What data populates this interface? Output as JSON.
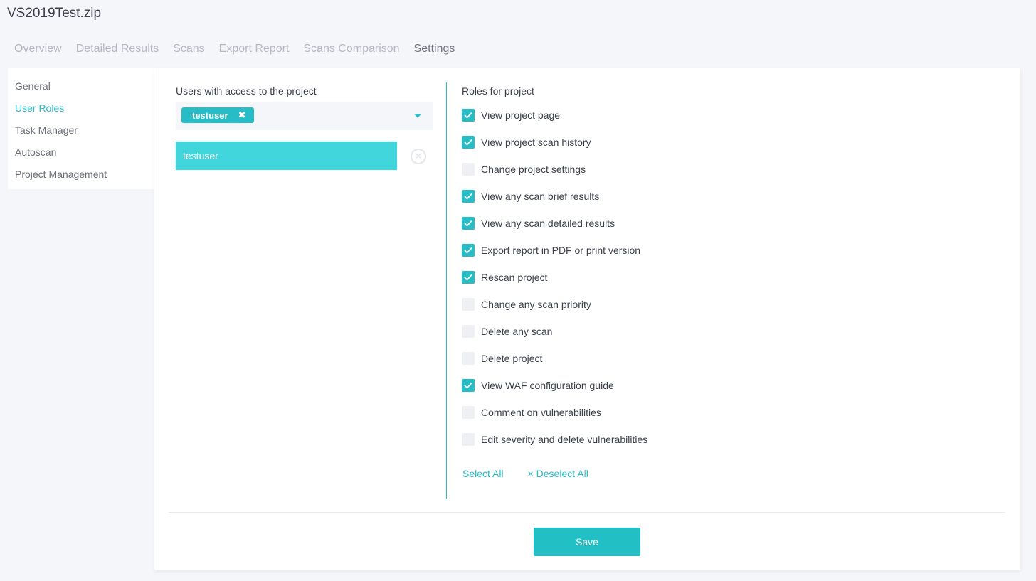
{
  "app": {
    "title": "VS2019Test.zip"
  },
  "tabs": [
    {
      "label": "Overview",
      "active": false
    },
    {
      "label": "Detailed Results",
      "active": false
    },
    {
      "label": "Scans",
      "active": false
    },
    {
      "label": "Export Report",
      "active": false
    },
    {
      "label": "Scans Comparison",
      "active": false
    },
    {
      "label": "Settings",
      "active": true
    }
  ],
  "sidebar": {
    "items": [
      {
        "label": "General",
        "active": false
      },
      {
        "label": "User Roles",
        "active": true
      },
      {
        "label": "Task Manager",
        "active": false
      },
      {
        "label": "Autoscan",
        "active": false
      },
      {
        "label": "Project Management",
        "active": false
      }
    ]
  },
  "users": {
    "label": "Users with access to the project",
    "selected_chip": "testuser",
    "list": [
      "testuser"
    ]
  },
  "roles": {
    "label": "Roles for project",
    "items": [
      {
        "label": "View project page",
        "checked": true
      },
      {
        "label": "View project scan history",
        "checked": true
      },
      {
        "label": "Change project settings",
        "checked": false
      },
      {
        "label": "View any scan brief results",
        "checked": true
      },
      {
        "label": "View any scan detailed results",
        "checked": true
      },
      {
        "label": "Export report in PDF or print version",
        "checked": true
      },
      {
        "label": "Rescan project",
        "checked": true
      },
      {
        "label": "Change any scan priority",
        "checked": false
      },
      {
        "label": "Delete any scan",
        "checked": false
      },
      {
        "label": "Delete project",
        "checked": false
      },
      {
        "label": "View WAF configuration guide",
        "checked": true
      },
      {
        "label": "Comment on vulnerabilities",
        "checked": false
      },
      {
        "label": "Edit severity and delete vulnerabilities",
        "checked": false
      }
    ],
    "select_all": "Select All",
    "deselect_all": "× Deselect All"
  },
  "actions": {
    "save_label": "Save"
  },
  "colors": {
    "accent": "#27bcc6",
    "selected_row": "#41d5dc",
    "checkbox_off": "#eef0f4"
  }
}
